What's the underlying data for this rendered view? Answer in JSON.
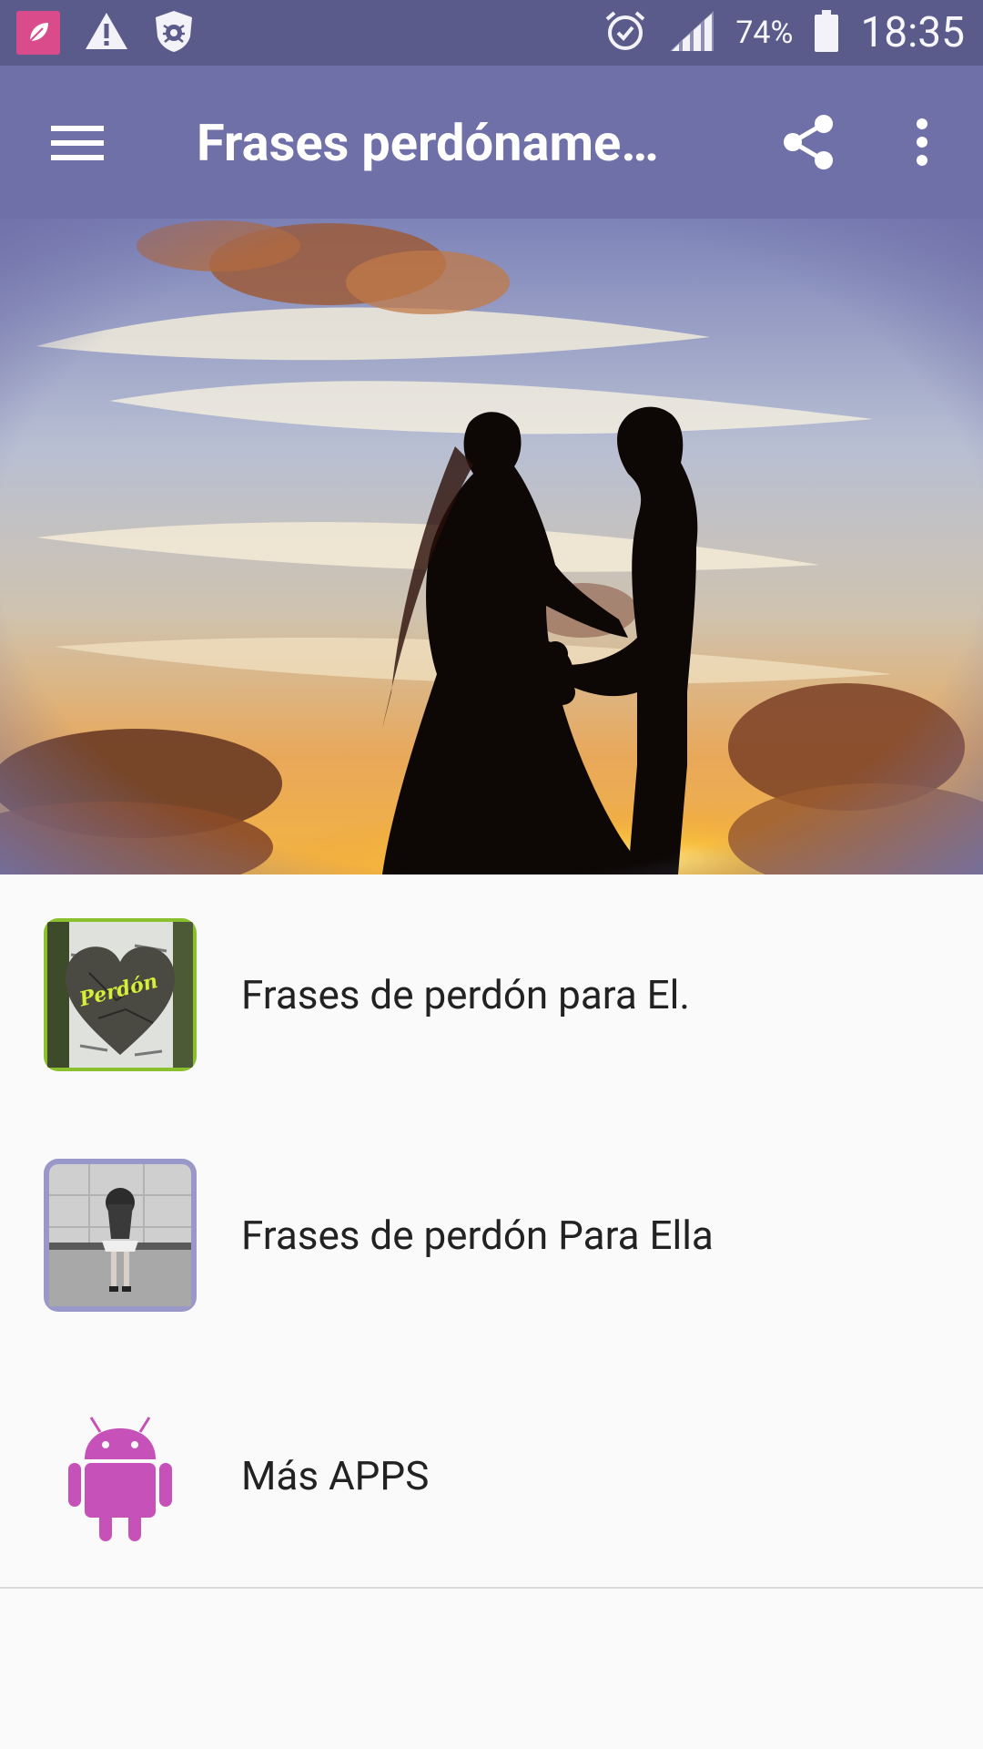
{
  "status_bar": {
    "battery_percent": "74%",
    "time": "18:35",
    "icons": [
      "app-notification-icon",
      "warning-icon",
      "shield-bug-icon",
      "alarm-icon",
      "signal-icon",
      "battery-icon"
    ]
  },
  "app_bar": {
    "title": "Frases perdóname…",
    "icons": [
      "menu-icon",
      "share-icon",
      "more-vert-icon"
    ]
  },
  "colors": {
    "status_bar": "#5a5b8a",
    "app_bar": "#7070a8",
    "background": "#fafafa",
    "android_icon": "#c651b9"
  },
  "menu": {
    "items": [
      {
        "label": "Frases de perdón para El.",
        "thumb_text": "Perdón"
      },
      {
        "label": "Frases de perdón Para Ella"
      },
      {
        "label": "Más APPS"
      }
    ]
  }
}
